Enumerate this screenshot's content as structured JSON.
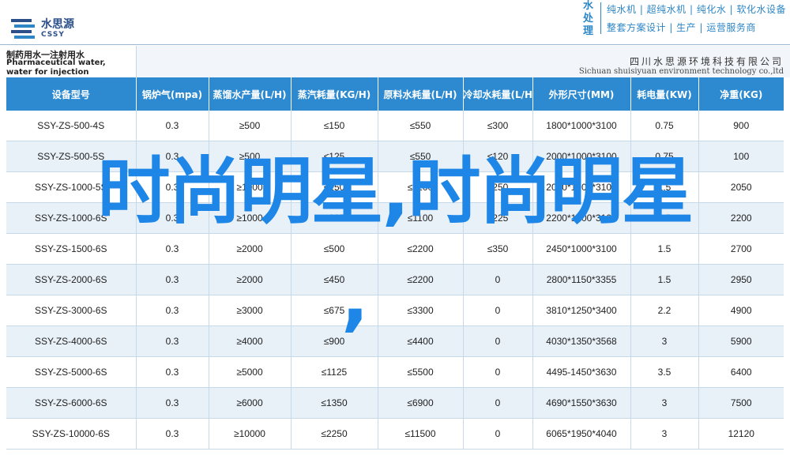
{
  "logo": {
    "name_cn": "水思源",
    "name_en": "CSSY",
    "icon": "water-drop-logo-icon"
  },
  "brand": {
    "vertical": "水处理",
    "line1": "纯水机 | 超纯水机 | 纯化水 | 软化水设备",
    "line2": "整套方案设计 | 生产 | 运营服务商"
  },
  "product": {
    "title_cn": "制药用水一注射用水",
    "title_en": "Pharmaceutical water, water for injection"
  },
  "company": {
    "name_cn": "四川水思源环境科技有限公司",
    "name_en": "Sichuan shuisiyuan environment technology co.,ltd"
  },
  "table": {
    "headers": [
      "设备型号",
      "锅炉气(mpa)",
      "蒸馏水产量(L/H)",
      "蒸汽耗量(KG/H)",
      "原料水耗量(L/H)",
      "冷却水耗量(L/H)",
      "外形尺寸(MM)",
      "耗电量(KW)",
      "净重(KG)"
    ],
    "rows": [
      [
        "SSY-ZS-500-4S",
        "0.3",
        "≥500",
        "≤150",
        "≤550",
        "≤300",
        "1800*1000*3100",
        "0.75",
        "900"
      ],
      [
        "SSY-ZS-500-5S",
        "0.3",
        "≥500",
        "≤125",
        "≤550",
        "≤120",
        "2000*1000*3100",
        "0.75",
        "100"
      ],
      [
        "SSY-ZS-1000-5S",
        "0.3",
        "≥1000",
        "≤250",
        "≤1100",
        "≤250",
        "2000*1000*3100",
        "1.5",
        "2050"
      ],
      [
        "SSY-ZS-1000-6S",
        "0.3",
        "≥1000",
        "≤225",
        "≤1100",
        "≤225",
        "2200*1000*3100",
        "1.5",
        "2200"
      ],
      [
        "SSY-ZS-1500-6S",
        "0.3",
        "≥2000",
        "≤500",
        "≤2200",
        "≤350",
        "2450*1000*3100",
        "1.5",
        "2700"
      ],
      [
        "SSY-ZS-2000-6S",
        "0.3",
        "≥2000",
        "≤450",
        "≤2200",
        "0",
        "2800*1150*3355",
        "1.5",
        "2950"
      ],
      [
        "SSY-ZS-3000-6S",
        "0.3",
        "≥3000",
        "≤675",
        "≤3300",
        "0",
        "3810*1250*3400",
        "2.2",
        "4900"
      ],
      [
        "SSY-ZS-4000-6S",
        "0.3",
        "≥4000",
        "≤900",
        "≤4400",
        "0",
        "4030*1350*3568",
        "3",
        "5900"
      ],
      [
        "SSY-ZS-5000-6S",
        "0.3",
        "≥5000",
        "≤1125",
        "≤5500",
        "0",
        "4495-1450*3630",
        "3.5",
        "6400"
      ],
      [
        "SSY-ZS-6000-6S",
        "0.3",
        "≥6000",
        "≤1350",
        "≤6900",
        "0",
        "4690*1550*3630",
        "3",
        "7500"
      ],
      [
        "SSY-ZS-10000-6S",
        "0.3",
        "≥10000",
        "≤2250",
        "≤11500",
        "0",
        "6065*1950*4040",
        "3",
        "12120"
      ]
    ]
  },
  "overlay": {
    "headline": "时尚明星,时尚明星",
    "comma": ",",
    "color": "#1e86e6"
  }
}
